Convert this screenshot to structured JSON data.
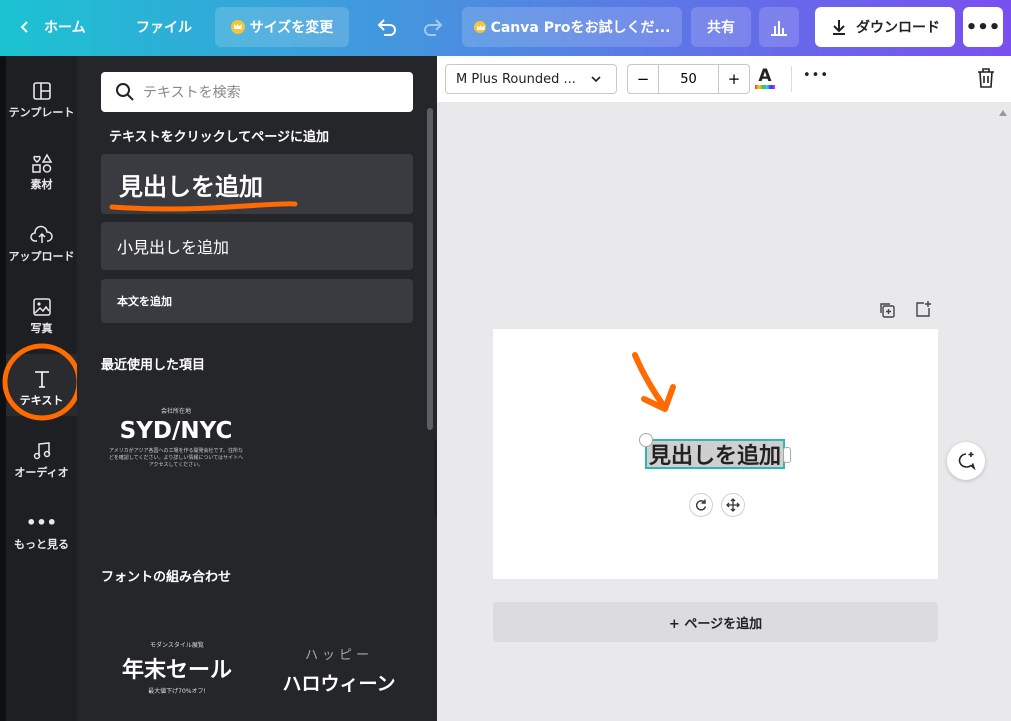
{
  "topbar": {
    "home_label": "ホーム",
    "file_label": "ファイル",
    "resize_label": "サイズを変更",
    "pro_label": "Canva Proをお試しくだ...",
    "share_label": "共有",
    "download_label": "ダウンロード",
    "more_icon": "more-icon"
  },
  "rail": {
    "items": [
      {
        "label": "テンプレート",
        "icon": "template-icon"
      },
      {
        "label": "素材",
        "icon": "elements-icon"
      },
      {
        "label": "アップロード",
        "icon": "upload-icon"
      },
      {
        "label": "写真",
        "icon": "photo-icon"
      },
      {
        "label": "テキスト",
        "icon": "text-icon"
      },
      {
        "label": "オーディオ",
        "icon": "audio-icon"
      },
      {
        "label": "もっと見る",
        "icon": "more-icon"
      }
    ],
    "active_index": 4
  },
  "panel": {
    "search_placeholder": "テキストを検索",
    "click_hint": "テキストをクリックしてページに追加",
    "heading_button": "見出しを追加",
    "subheading_button": "小見出しを追加",
    "body_button": "本文を追加",
    "recent_title": "最近使用した項目",
    "recent_item": {
      "top": "会社所在地",
      "main": "SYD/NYC",
      "body": "アメリカがアジア各国への工場を作る開発会社です。住所などを確認してください。より詳しい情報についてはサイトへアクセスしてください。"
    },
    "font_combo_title": "フォントの組み合わせ",
    "combo1": {
      "top": "モダンスタイル展覧",
      "main": "年末セール",
      "bottom": "最大値下げ70%オフ!"
    },
    "combo2": {
      "top": "ハッピー",
      "main": "ハロウィーン"
    }
  },
  "toolbar": {
    "font_name": "M Plus Rounded ...",
    "font_size": "50",
    "minus": "−",
    "plus": "+",
    "text_color_letter": "A"
  },
  "canvas": {
    "selected_text": "見出しを追加",
    "add_page": "+ ページを追加"
  },
  "colors": {
    "annotation": "#ff6b00",
    "selection": "#2db8b6"
  }
}
